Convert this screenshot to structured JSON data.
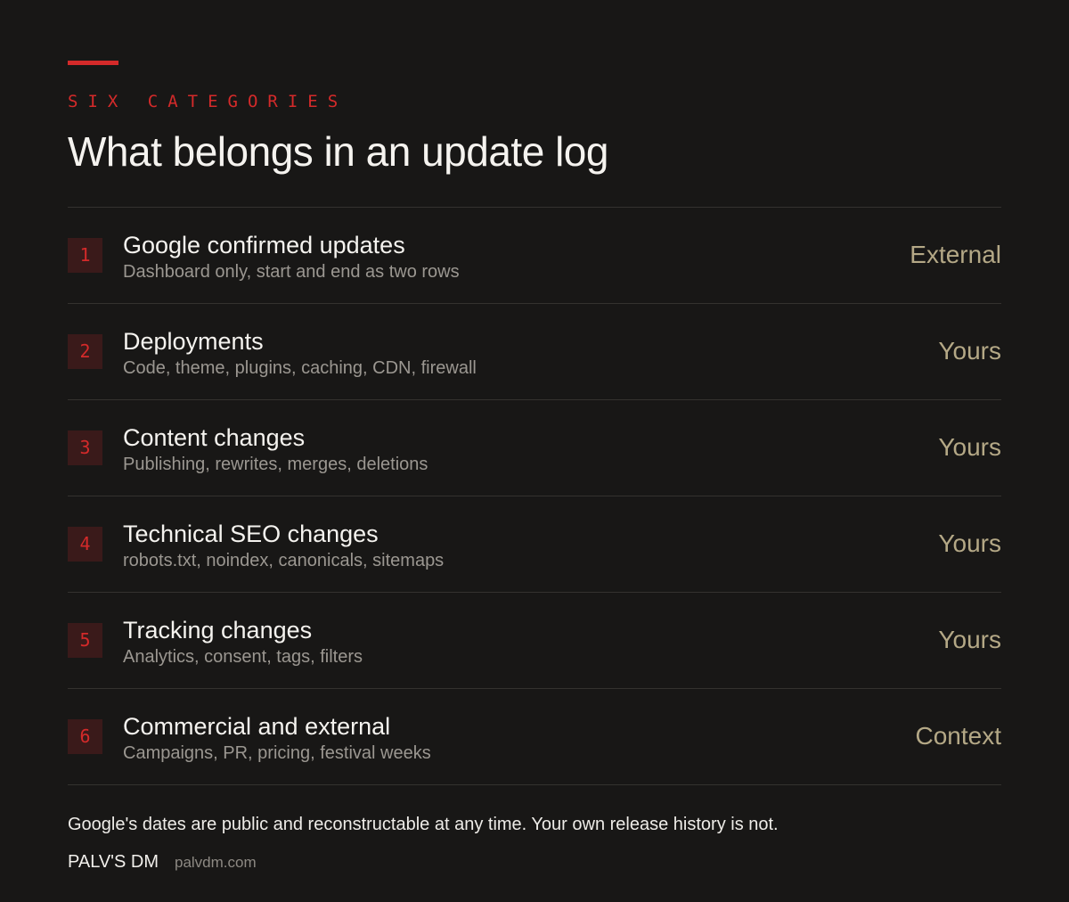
{
  "header": {
    "kicker": "SIX CATEGORIES",
    "title": "What belongs in an update log"
  },
  "categories": [
    {
      "number": "1",
      "title": "Google confirmed updates",
      "description": "Dashboard only, start and end as two rows",
      "tag": "External"
    },
    {
      "number": "2",
      "title": "Deployments",
      "description": "Code, theme, plugins, caching, CDN, firewall",
      "tag": "Yours"
    },
    {
      "number": "3",
      "title": "Content changes",
      "description": "Publishing, rewrites, merges, deletions",
      "tag": "Yours"
    },
    {
      "number": "4",
      "title": "Technical SEO changes",
      "description": "robots.txt, noindex, canonicals, sitemaps",
      "tag": "Yours"
    },
    {
      "number": "5",
      "title": "Tracking changes",
      "description": "Analytics, consent, tags, filters",
      "tag": "Yours"
    },
    {
      "number": "6",
      "title": "Commercial and external",
      "description": "Campaigns, PR, pricing, festival weeks",
      "tag": "Context"
    }
  ],
  "footer": {
    "note": "Google's dates are public and reconstructable at any time. Your own release history is not.",
    "brand": "PALV'S DM",
    "domain": "palvdm.com"
  },
  "colors": {
    "background": "#181716",
    "accent": "#d42a2a",
    "tag": "#b4a886"
  }
}
